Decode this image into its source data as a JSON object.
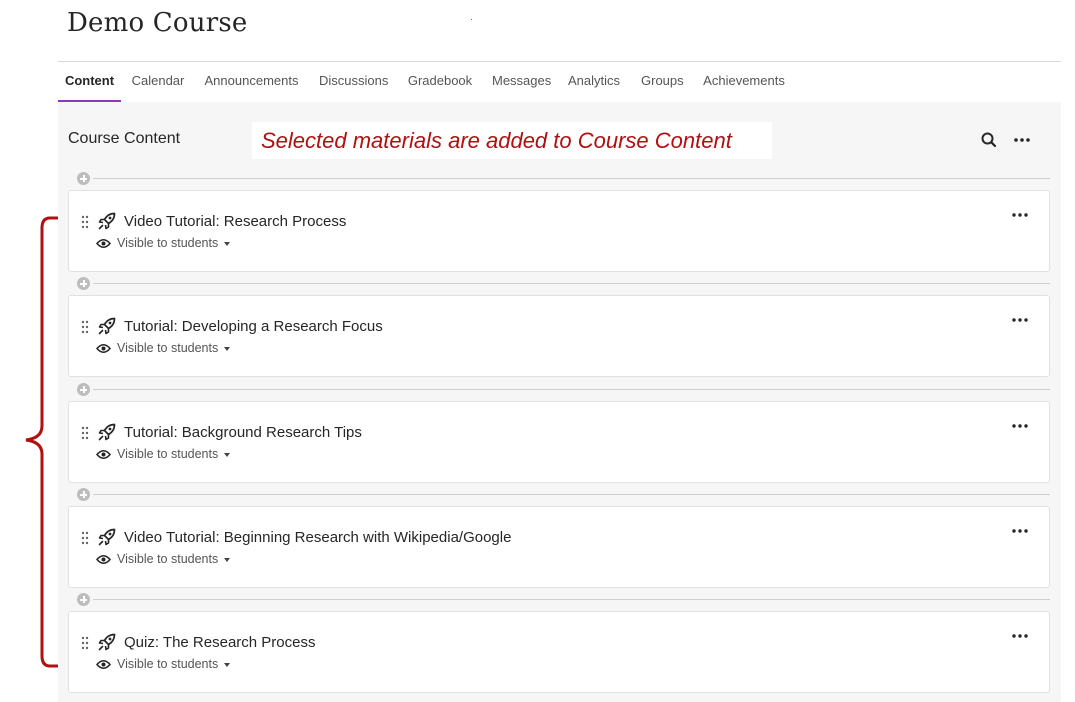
{
  "course": {
    "title": "Demo Course"
  },
  "nav": {
    "tabs": [
      {
        "label": "Content",
        "active": true
      },
      {
        "label": "Calendar"
      },
      {
        "label": "Announcements"
      },
      {
        "label": "Discussions"
      },
      {
        "label": "Gradebook"
      },
      {
        "label": "Messages"
      },
      {
        "label": "Analytics"
      },
      {
        "label": "Groups"
      },
      {
        "label": "Achievements"
      }
    ],
    "accent_color": "#8f37b8"
  },
  "content": {
    "title": "Course Content",
    "callout": "Selected materials are added to Course Content",
    "callout_color": "#b01010",
    "icons": {
      "search": "search-icon",
      "more": "more-options-icon"
    },
    "items": [
      {
        "title": "Video Tutorial: Research Process",
        "visibility": "Visible to students",
        "icon": "rocket-icon"
      },
      {
        "title": "Tutorial: Developing a Research Focus",
        "visibility": "Visible to students",
        "icon": "rocket-icon"
      },
      {
        "title": "Tutorial: Background Research Tips",
        "visibility": "Visible to students",
        "icon": "rocket-icon"
      },
      {
        "title": "Video Tutorial: Beginning Research with Wikipedia/Google",
        "visibility": "Visible to students",
        "icon": "rocket-icon"
      },
      {
        "title": "Quiz: The Research Process",
        "visibility": "Visible to students",
        "icon": "rocket-icon"
      }
    ]
  }
}
